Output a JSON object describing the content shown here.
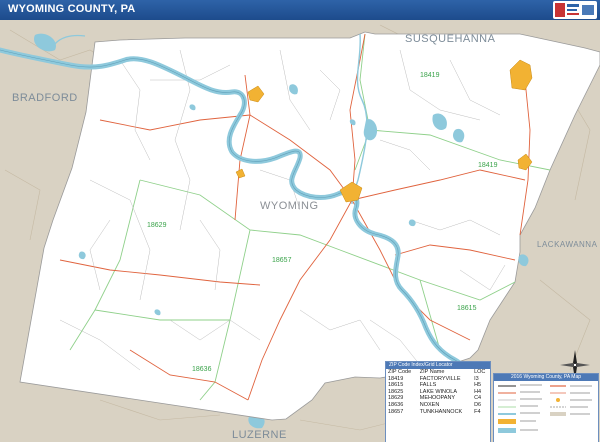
{
  "map": {
    "title": "WYOMING COUNTY, PA",
    "colors": {
      "water": "#8ec9dc",
      "county_fill": "#ffffff",
      "outside": "#d9d2c3",
      "urban": "#f2b233",
      "roads": "#e0633e",
      "zip_boundary": "#8fd08a"
    }
  },
  "labels": {
    "home_county": "WYOMING",
    "neighbors": {
      "susquehanna": "SUSQUEHANNA",
      "bradford": "BRADFORD",
      "lackawanna": "LACKAWANNA",
      "luzerne": "LUZERNE"
    }
  },
  "zip_labels": [
    "18419",
    "18419",
    "18629",
    "18657",
    "18615",
    "18636"
  ],
  "zip_index": {
    "header": "ZIP Code Index/Grid Locator",
    "columns": [
      "ZIP Code",
      "ZIP Name",
      "LOC"
    ],
    "rows": [
      [
        "18419",
        "FACTORYVILLE",
        "I3"
      ],
      [
        "18615",
        "FALLS",
        "H5"
      ],
      [
        "18625",
        "LAKE WINOLA",
        "H4"
      ],
      [
        "18629",
        "MEHOOPANY",
        "C4"
      ],
      [
        "18636",
        "NOXEN",
        "D6"
      ],
      [
        "18657",
        "TUNKHANNOCK",
        "F4"
      ]
    ]
  },
  "legend": {
    "title": "2016 Wyoming County, PA Map"
  },
  "compass": {
    "icon": "compass-rose-icon"
  }
}
